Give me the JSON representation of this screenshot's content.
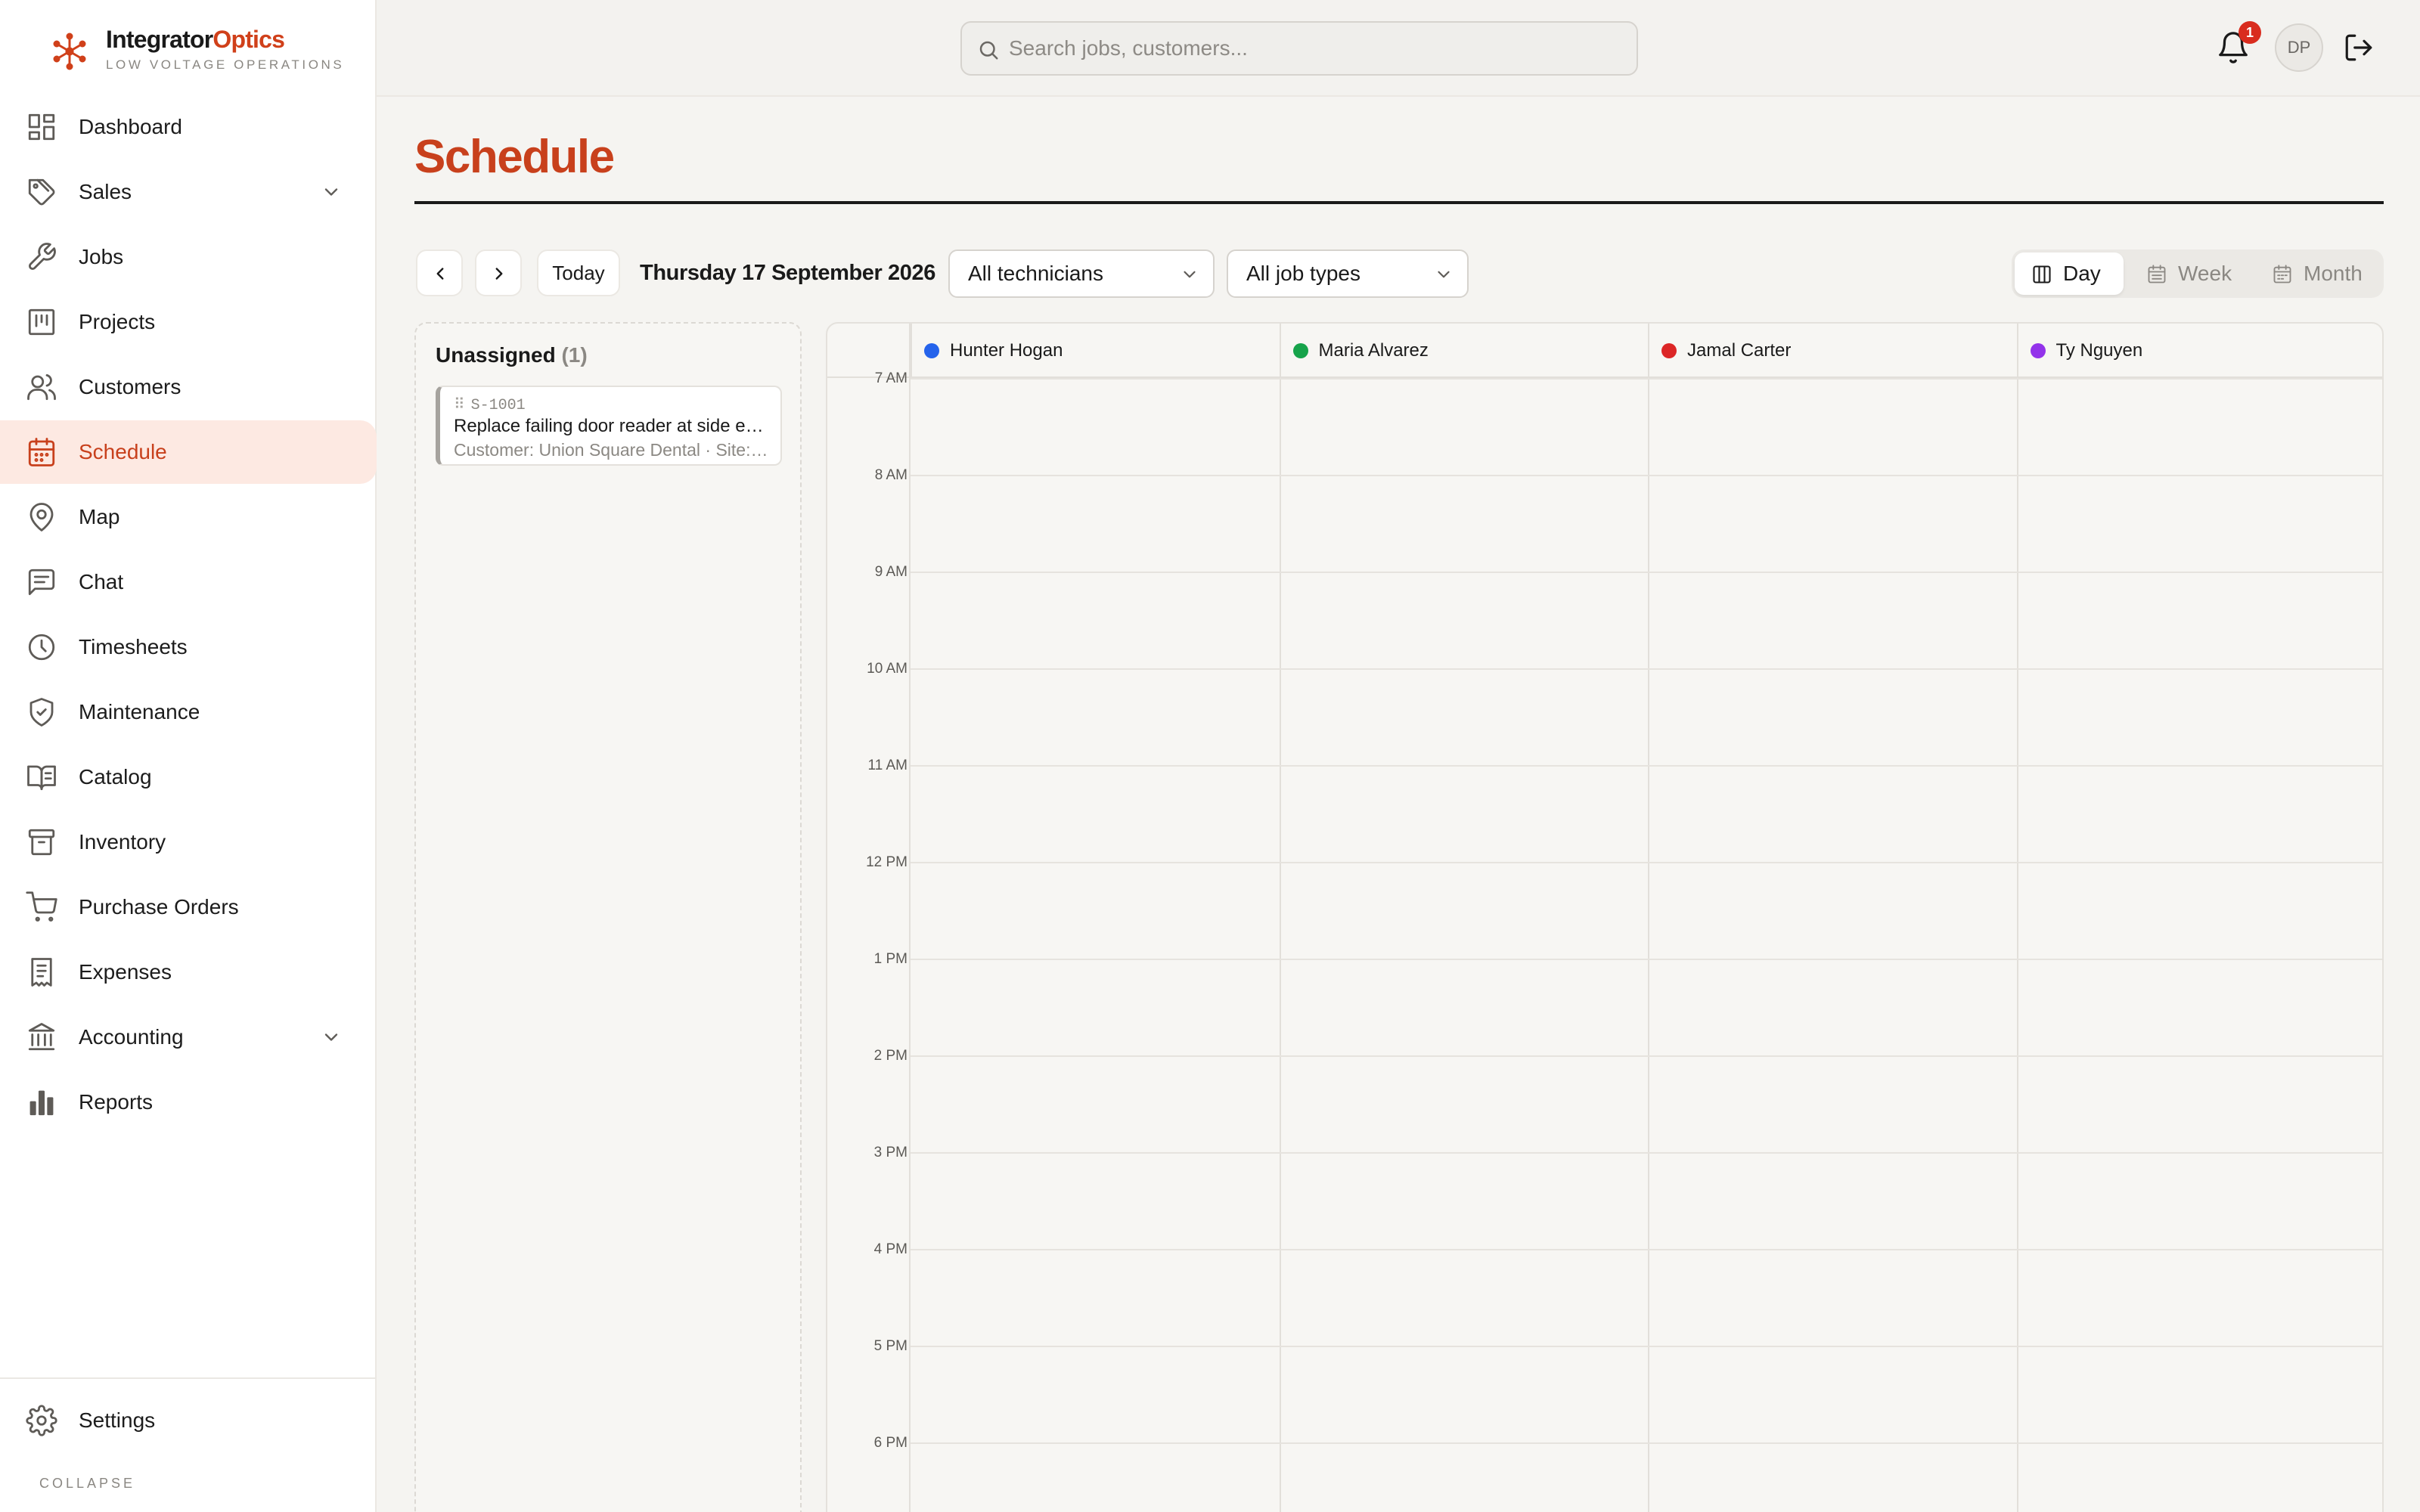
{
  "brand": {
    "name_part1": "Integrator",
    "name_part2": "Optics",
    "tagline": "LOW VOLTAGE OPERATIONS",
    "accent_color": "#d0401a"
  },
  "sidebar": {
    "items": [
      {
        "label": "Dashboard",
        "icon": "dashboard-icon",
        "active": false,
        "has_chevron": false
      },
      {
        "label": "Sales",
        "icon": "tag-icon",
        "active": false,
        "has_chevron": true
      },
      {
        "label": "Jobs",
        "icon": "wrench-icon",
        "active": false,
        "has_chevron": false
      },
      {
        "label": "Projects",
        "icon": "kanban-icon",
        "active": false,
        "has_chevron": false
      },
      {
        "label": "Customers",
        "icon": "users-icon",
        "active": false,
        "has_chevron": false
      },
      {
        "label": "Schedule",
        "icon": "calendar-icon",
        "active": true,
        "has_chevron": false
      },
      {
        "label": "Map",
        "icon": "map-pin-icon",
        "active": false,
        "has_chevron": false
      },
      {
        "label": "Chat",
        "icon": "chat-icon",
        "active": false,
        "has_chevron": false
      },
      {
        "label": "Timesheets",
        "icon": "clock-icon",
        "active": false,
        "has_chevron": false
      },
      {
        "label": "Maintenance",
        "icon": "shield-check-icon",
        "active": false,
        "has_chevron": false
      },
      {
        "label": "Catalog",
        "icon": "book-icon",
        "active": false,
        "has_chevron": false
      },
      {
        "label": "Inventory",
        "icon": "archive-icon",
        "active": false,
        "has_chevron": false
      },
      {
        "label": "Purchase Orders",
        "icon": "cart-icon",
        "active": false,
        "has_chevron": false
      },
      {
        "label": "Expenses",
        "icon": "receipt-icon",
        "active": false,
        "has_chevron": false
      },
      {
        "label": "Accounting",
        "icon": "bank-icon",
        "active": false,
        "has_chevron": true
      },
      {
        "label": "Reports",
        "icon": "bar-chart-icon",
        "active": false,
        "has_chevron": false
      }
    ],
    "settings_label": "Settings",
    "collapse_label": "COLLAPSE"
  },
  "topbar": {
    "search_placeholder": "Search jobs, customers...",
    "search_value": "",
    "notification_count": "1",
    "avatar_initials": "DP"
  },
  "page": {
    "title": "Schedule"
  },
  "toolbar": {
    "today_label": "Today",
    "date_label": "Thursday 17 September 2026",
    "technician_filter": "All technicians",
    "job_type_filter": "All job types",
    "views": [
      {
        "label": "Day",
        "icon": "columns-icon",
        "active": true
      },
      {
        "label": "Week",
        "icon": "calendar-week-icon",
        "active": false
      },
      {
        "label": "Month",
        "icon": "calendar-month-icon",
        "active": false
      }
    ]
  },
  "unassigned": {
    "heading": "Unassigned",
    "count": "(1)",
    "jobs": [
      {
        "id": "S-1001",
        "title": "Replace failing door reader at side entrance",
        "subtitle": "Customer: Union Square Dental · Site: Union Square Dental"
      }
    ]
  },
  "calendar": {
    "technicians": [
      {
        "name": "Hunter Hogan",
        "color": "#2563eb"
      },
      {
        "name": "Maria Alvarez",
        "color": "#16a34a"
      },
      {
        "name": "Jamal Carter",
        "color": "#dc2626"
      },
      {
        "name": "Ty Nguyen",
        "color": "#9333ea"
      }
    ],
    "hours": [
      "7 AM",
      "8 AM",
      "9 AM",
      "10 AM",
      "11 AM",
      "12 PM",
      "1 PM",
      "2 PM",
      "3 PM",
      "4 PM",
      "5 PM",
      "6 PM"
    ]
  }
}
